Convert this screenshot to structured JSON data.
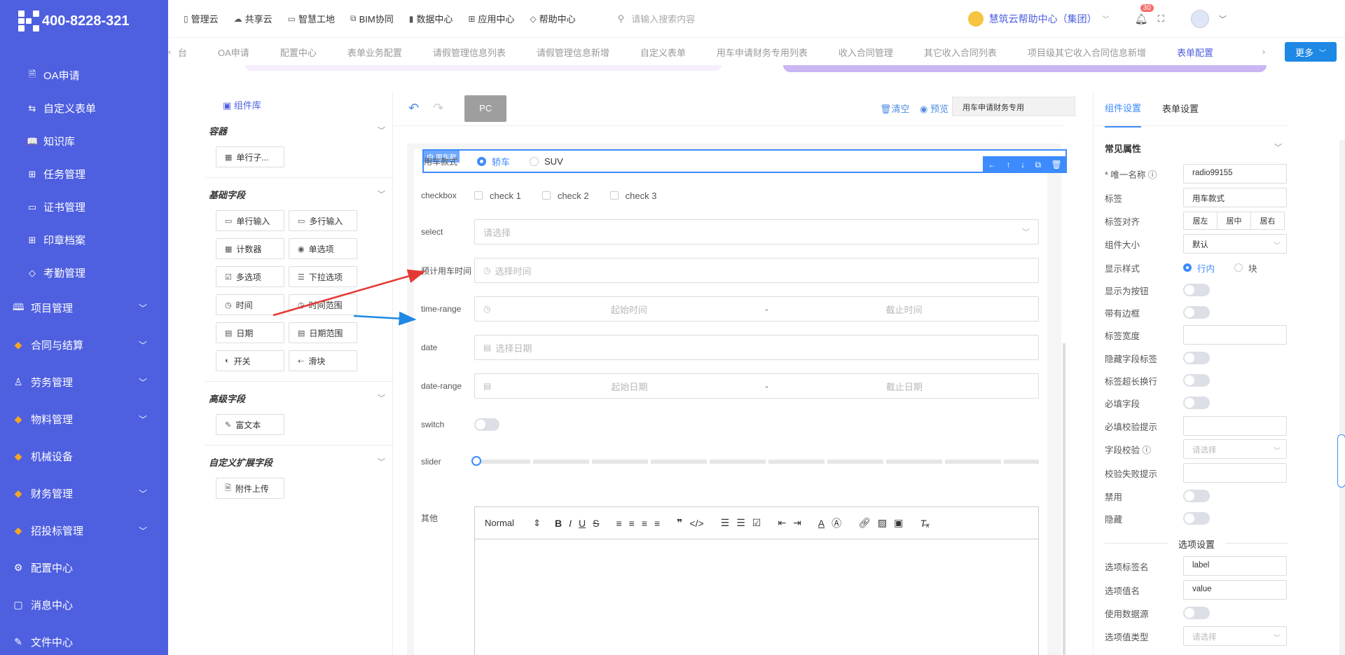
{
  "brand": {
    "phone": "400-8228-321"
  },
  "sidebar": {
    "sub_items": [
      {
        "icon": "document-icon",
        "glyph": "🗎",
        "label": "OA申请"
      },
      {
        "icon": "form-icon",
        "glyph": "⇆",
        "label": "自定义表单"
      },
      {
        "icon": "book-icon",
        "glyph": "📖",
        "label": "知识库"
      },
      {
        "icon": "tree-icon",
        "glyph": "⊞",
        "label": "任务管理"
      },
      {
        "icon": "certificate-icon",
        "glyph": "▭",
        "label": "证书管理"
      },
      {
        "icon": "grid-icon",
        "glyph": "⊞",
        "label": "印章档案"
      },
      {
        "icon": "tag-icon",
        "glyph": "◇",
        "label": "考勤管理"
      }
    ],
    "top_items": [
      {
        "icon": "book-icon",
        "glyph": "🕮",
        "label": "项目管理",
        "expandable": true
      },
      {
        "icon": "gem-icon",
        "glyph": "◆",
        "label": "合同与结算",
        "expandable": true
      },
      {
        "icon": "user-icon",
        "glyph": "♙",
        "label": "劳务管理",
        "expandable": true
      },
      {
        "icon": "gem-icon",
        "glyph": "◆",
        "label": "物料管理",
        "expandable": true
      },
      {
        "icon": "gem-icon",
        "glyph": "◆",
        "label": "机械设备",
        "expandable": false
      },
      {
        "icon": "gem-icon",
        "glyph": "◆",
        "label": "财务管理",
        "expandable": true
      },
      {
        "icon": "gem-icon",
        "glyph": "◆",
        "label": "招投标管理",
        "expandable": true
      },
      {
        "icon": "gear-icon",
        "glyph": "⚙",
        "label": "配置中心",
        "expandable": false
      },
      {
        "icon": "chat-icon",
        "glyph": "▢",
        "label": "消息中心",
        "expandable": false
      },
      {
        "icon": "edit-icon",
        "glyph": "✎",
        "label": "文件中心",
        "expandable": false
      }
    ]
  },
  "topnav": {
    "items": [
      "管理云",
      "共享云",
      "智慧工地",
      "BIM协同",
      "数据中心",
      "应用中心",
      "帮助中心"
    ],
    "search_placeholder": "请输入搜索内容",
    "help_center": "慧筑云帮助中心（集团）",
    "notification_count": "30"
  },
  "tabs": {
    "items": [
      "台",
      "OA申请",
      "配置中心",
      "表单业务配置",
      "请假管理信息列表",
      "请假管理信息新增",
      "自定义表单",
      "用车申请财务专用列表",
      "收入合同管理",
      "其它收入合同列表",
      "项目级其它收入合同信息新增",
      "表单配置"
    ],
    "active": "表单配置",
    "more_label": "更多"
  },
  "library": {
    "title": "组件库",
    "groups": [
      {
        "title": "容器",
        "items": [
          {
            "icon": "table-icon",
            "glyph": "▦",
            "label": "单行子..."
          }
        ]
      },
      {
        "title": "基础字段",
        "items": [
          {
            "icon": "input-icon",
            "glyph": "▭",
            "label": "单行输入"
          },
          {
            "icon": "textarea-icon",
            "glyph": "▭",
            "label": "多行输入"
          },
          {
            "icon": "counter-icon",
            "glyph": "▦",
            "label": "计数器"
          },
          {
            "icon": "radio-icon",
            "glyph": "◉",
            "label": "单选项"
          },
          {
            "icon": "checkbox-icon",
            "glyph": "☑",
            "label": "多选项"
          },
          {
            "icon": "list-icon",
            "glyph": "☰",
            "label": "下拉选项"
          },
          {
            "icon": "clock-icon",
            "glyph": "◷",
            "label": "时间"
          },
          {
            "icon": "clock-range-icon",
            "glyph": "◷",
            "label": "时间范围"
          },
          {
            "icon": "calendar-icon",
            "glyph": "▤",
            "label": "日期"
          },
          {
            "icon": "calendar-range-icon",
            "glyph": "▤",
            "label": "日期范围"
          },
          {
            "icon": "toggle-icon",
            "glyph": "◐",
            "label": "开关"
          },
          {
            "icon": "slider-icon",
            "glyph": "⇠",
            "label": "滑块"
          }
        ]
      },
      {
        "title": "高级字段",
        "items": [
          {
            "icon": "rich-text-icon",
            "glyph": "✎",
            "label": "富文本"
          }
        ]
      },
      {
        "title": "自定义扩展字段",
        "items": [
          {
            "icon": "upload-icon",
            "glyph": "🗎",
            "label": "附件上传"
          }
        ]
      }
    ]
  },
  "designer": {
    "device": "PC",
    "clear": "清空",
    "preview": "预览",
    "form_name": "用车申请财务专用",
    "selected_tag": "中 用车款",
    "fields": {
      "radio_label": "用车款式",
      "radio_options": [
        "轿车",
        "SUV"
      ],
      "checkbox_label": "checkbox",
      "checkbox_options": [
        "check 1",
        "check 2",
        "check 3"
      ],
      "select_label": "select",
      "select_placeholder": "请选择",
      "time_label": "预计用车时间",
      "time_placeholder": "选择时间",
      "time_range_label": "time-range",
      "time_range_start": "起始时间",
      "time_range_end": "截止时间",
      "date_label": "date",
      "date_placeholder": "选择日期",
      "date_range_label": "date-range",
      "date_range_start": "起始日期",
      "date_range_end": "截止日期",
      "range_sep": "-",
      "switch_label": "switch",
      "slider_label": "slider",
      "rich_label": "其他",
      "rich_font": "Normal"
    }
  },
  "props": {
    "tabs": [
      "组件设置",
      "表单设置"
    ],
    "section": "常见属性",
    "unique_name_label": "* 唯一名称",
    "unique_name": "radio99155",
    "label_label": "标签",
    "label_value": "用车款式",
    "align_label": "标签对齐",
    "align_options": [
      "居左",
      "居中",
      "居右"
    ],
    "size_label": "组件大小",
    "size_value": "默认",
    "style_label": "显示样式",
    "style_options": [
      "行内",
      "块"
    ],
    "as_button": "显示为按钮",
    "with_border": "带有边框",
    "label_width": "标签宽度",
    "hide_label": "隐藏字段标签",
    "label_wrap": "标签超长换行",
    "required": "必填字段",
    "required_hint": "必填校验提示",
    "validation": "字段校验",
    "validation_placeholder": "请选择",
    "fail_hint": "校验失败提示",
    "disabled": "禁用",
    "hidden": "隐藏",
    "option_section": "选项设置",
    "option_label_name": "选项标签名",
    "option_label_value": "label",
    "option_value_name": "选项值名",
    "option_value_value": "value",
    "use_datasource": "使用数据源",
    "option_value_type": "选项值类型",
    "option_value_type_placeholder": "请选择"
  },
  "colors": {
    "sidebar": "#4e5fe0",
    "accent": "#3d8bfd",
    "arrow_red": "#e53935",
    "arrow_blue": "#1e88e5"
  }
}
